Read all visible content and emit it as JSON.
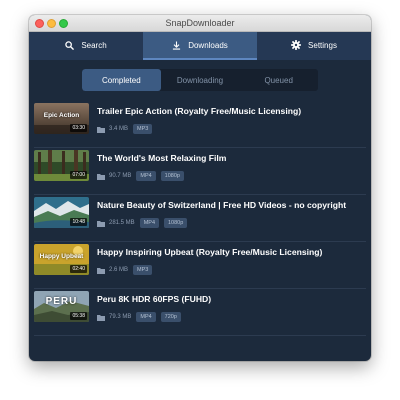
{
  "window": {
    "title": "SnapDownloader"
  },
  "nav": {
    "search": "Search",
    "downloads": "Downloads",
    "settings": "Settings"
  },
  "segments": {
    "completed": "Completed",
    "downloading": "Downloading",
    "queued": "Queued"
  },
  "colors": {
    "accent": "#3c5b83",
    "background": "#1c2a3c",
    "navbar": "#253854"
  },
  "downloads": [
    {
      "title": "Trailer Epic Action (Royalty Free/Music Licensing)",
      "thumb_text": "Epic Action",
      "duration": "03:30",
      "size": "3.4 MB",
      "format": "MP3"
    },
    {
      "title": "The World's Most Relaxing Film",
      "duration": "07:00",
      "size": "90.7 MB",
      "format": "MP4",
      "quality": "1080p"
    },
    {
      "title": "Nature Beauty of Switzerland | Free HD Videos - no copyright",
      "duration": "10:48",
      "size": "281.5 MB",
      "format": "MP4",
      "quality": "1080p"
    },
    {
      "title": "Happy Inspiring Upbeat (Royalty Free/Music Licensing)",
      "thumb_text": "Happy Upbeat",
      "duration": "02:40",
      "size": "2.6 MB",
      "format": "MP3"
    },
    {
      "title": "Peru 8K HDR 60FPS (FUHD)",
      "thumb_text": "PERU",
      "duration": "05:38",
      "size": "79.3 MB",
      "format": "MP4",
      "quality": "720p"
    }
  ]
}
